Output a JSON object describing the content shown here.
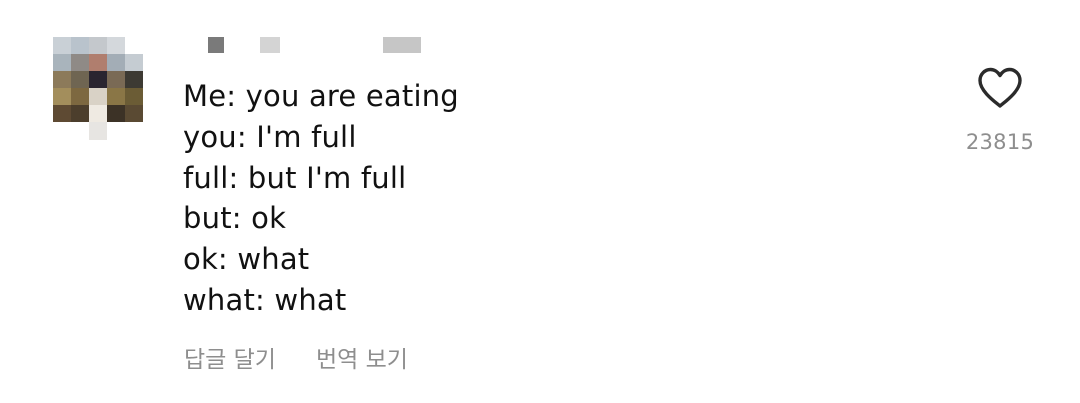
{
  "comment": {
    "avatar_colors": [
      "#c9d0d6",
      "#b9c3cc",
      "#c4c8cc",
      "#d4d8dc",
      "#ffffff",
      "#a9b4bc",
      "#8f8a86",
      "#b07e6e",
      "#a3adb6",
      "#c5ccd2",
      "#8c7a5a",
      "#6f6552",
      "#2a2530",
      "#7a6a55",
      "#3d3a33",
      "#a38e5c",
      "#7d6840",
      "#d9d2c6",
      "#8a7646",
      "#6b5c35",
      "#5e4a33",
      "#4c3e2c",
      "#efeae2",
      "#3c3226",
      "#5a4a33",
      "#ffffff",
      "#ffffff",
      "#e7e5e2",
      "#ffffff",
      "#ffffff"
    ],
    "lines": [
      "Me: you are eating",
      "you: I'm full",
      "full: but I'm full",
      "but: ok",
      "ok: what",
      "what: what"
    ],
    "actions": {
      "reply": "답글 달기",
      "translate": "번역 보기"
    },
    "likes": {
      "count": "23815",
      "icon": "heart-icon"
    }
  }
}
